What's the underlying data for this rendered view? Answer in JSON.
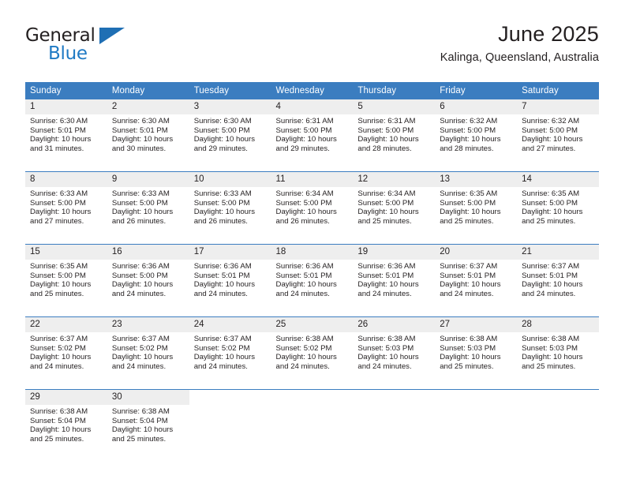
{
  "brand": {
    "name_top": "General",
    "name_bottom": "Blue",
    "triangle_color": "#1f6fb4",
    "blue_color": "#1f7ac4"
  },
  "header": {
    "title": "June 2025",
    "subtitle": "Kalinga, Queensland, Australia"
  },
  "theme": {
    "header_blue": "#3b7dc0",
    "daynum_band": "#eeeeee",
    "text": "#231f20"
  },
  "weekdays": [
    "Sunday",
    "Monday",
    "Tuesday",
    "Wednesday",
    "Thursday",
    "Friday",
    "Saturday"
  ],
  "weeks": [
    [
      {
        "day": "1",
        "sunrise": "Sunrise: 6:30 AM",
        "sunset": "Sunset: 5:01 PM",
        "daylight1": "Daylight: 10 hours",
        "daylight2": "and 31 minutes."
      },
      {
        "day": "2",
        "sunrise": "Sunrise: 6:30 AM",
        "sunset": "Sunset: 5:01 PM",
        "daylight1": "Daylight: 10 hours",
        "daylight2": "and 30 minutes."
      },
      {
        "day": "3",
        "sunrise": "Sunrise: 6:30 AM",
        "sunset": "Sunset: 5:00 PM",
        "daylight1": "Daylight: 10 hours",
        "daylight2": "and 29 minutes."
      },
      {
        "day": "4",
        "sunrise": "Sunrise: 6:31 AM",
        "sunset": "Sunset: 5:00 PM",
        "daylight1": "Daylight: 10 hours",
        "daylight2": "and 29 minutes."
      },
      {
        "day": "5",
        "sunrise": "Sunrise: 6:31 AM",
        "sunset": "Sunset: 5:00 PM",
        "daylight1": "Daylight: 10 hours",
        "daylight2": "and 28 minutes."
      },
      {
        "day": "6",
        "sunrise": "Sunrise: 6:32 AM",
        "sunset": "Sunset: 5:00 PM",
        "daylight1": "Daylight: 10 hours",
        "daylight2": "and 28 minutes."
      },
      {
        "day": "7",
        "sunrise": "Sunrise: 6:32 AM",
        "sunset": "Sunset: 5:00 PM",
        "daylight1": "Daylight: 10 hours",
        "daylight2": "and 27 minutes."
      }
    ],
    [
      {
        "day": "8",
        "sunrise": "Sunrise: 6:33 AM",
        "sunset": "Sunset: 5:00 PM",
        "daylight1": "Daylight: 10 hours",
        "daylight2": "and 27 minutes."
      },
      {
        "day": "9",
        "sunrise": "Sunrise: 6:33 AM",
        "sunset": "Sunset: 5:00 PM",
        "daylight1": "Daylight: 10 hours",
        "daylight2": "and 26 minutes."
      },
      {
        "day": "10",
        "sunrise": "Sunrise: 6:33 AM",
        "sunset": "Sunset: 5:00 PM",
        "daylight1": "Daylight: 10 hours",
        "daylight2": "and 26 minutes."
      },
      {
        "day": "11",
        "sunrise": "Sunrise: 6:34 AM",
        "sunset": "Sunset: 5:00 PM",
        "daylight1": "Daylight: 10 hours",
        "daylight2": "and 26 minutes."
      },
      {
        "day": "12",
        "sunrise": "Sunrise: 6:34 AM",
        "sunset": "Sunset: 5:00 PM",
        "daylight1": "Daylight: 10 hours",
        "daylight2": "and 25 minutes."
      },
      {
        "day": "13",
        "sunrise": "Sunrise: 6:35 AM",
        "sunset": "Sunset: 5:00 PM",
        "daylight1": "Daylight: 10 hours",
        "daylight2": "and 25 minutes."
      },
      {
        "day": "14",
        "sunrise": "Sunrise: 6:35 AM",
        "sunset": "Sunset: 5:00 PM",
        "daylight1": "Daylight: 10 hours",
        "daylight2": "and 25 minutes."
      }
    ],
    [
      {
        "day": "15",
        "sunrise": "Sunrise: 6:35 AM",
        "sunset": "Sunset: 5:00 PM",
        "daylight1": "Daylight: 10 hours",
        "daylight2": "and 25 minutes."
      },
      {
        "day": "16",
        "sunrise": "Sunrise: 6:36 AM",
        "sunset": "Sunset: 5:00 PM",
        "daylight1": "Daylight: 10 hours",
        "daylight2": "and 24 minutes."
      },
      {
        "day": "17",
        "sunrise": "Sunrise: 6:36 AM",
        "sunset": "Sunset: 5:01 PM",
        "daylight1": "Daylight: 10 hours",
        "daylight2": "and 24 minutes."
      },
      {
        "day": "18",
        "sunrise": "Sunrise: 6:36 AM",
        "sunset": "Sunset: 5:01 PM",
        "daylight1": "Daylight: 10 hours",
        "daylight2": "and 24 minutes."
      },
      {
        "day": "19",
        "sunrise": "Sunrise: 6:36 AM",
        "sunset": "Sunset: 5:01 PM",
        "daylight1": "Daylight: 10 hours",
        "daylight2": "and 24 minutes."
      },
      {
        "day": "20",
        "sunrise": "Sunrise: 6:37 AM",
        "sunset": "Sunset: 5:01 PM",
        "daylight1": "Daylight: 10 hours",
        "daylight2": "and 24 minutes."
      },
      {
        "day": "21",
        "sunrise": "Sunrise: 6:37 AM",
        "sunset": "Sunset: 5:01 PM",
        "daylight1": "Daylight: 10 hours",
        "daylight2": "and 24 minutes."
      }
    ],
    [
      {
        "day": "22",
        "sunrise": "Sunrise: 6:37 AM",
        "sunset": "Sunset: 5:02 PM",
        "daylight1": "Daylight: 10 hours",
        "daylight2": "and 24 minutes."
      },
      {
        "day": "23",
        "sunrise": "Sunrise: 6:37 AM",
        "sunset": "Sunset: 5:02 PM",
        "daylight1": "Daylight: 10 hours",
        "daylight2": "and 24 minutes."
      },
      {
        "day": "24",
        "sunrise": "Sunrise: 6:37 AM",
        "sunset": "Sunset: 5:02 PM",
        "daylight1": "Daylight: 10 hours",
        "daylight2": "and 24 minutes."
      },
      {
        "day": "25",
        "sunrise": "Sunrise: 6:38 AM",
        "sunset": "Sunset: 5:02 PM",
        "daylight1": "Daylight: 10 hours",
        "daylight2": "and 24 minutes."
      },
      {
        "day": "26",
        "sunrise": "Sunrise: 6:38 AM",
        "sunset": "Sunset: 5:03 PM",
        "daylight1": "Daylight: 10 hours",
        "daylight2": "and 24 minutes."
      },
      {
        "day": "27",
        "sunrise": "Sunrise: 6:38 AM",
        "sunset": "Sunset: 5:03 PM",
        "daylight1": "Daylight: 10 hours",
        "daylight2": "and 25 minutes."
      },
      {
        "day": "28",
        "sunrise": "Sunrise: 6:38 AM",
        "sunset": "Sunset: 5:03 PM",
        "daylight1": "Daylight: 10 hours",
        "daylight2": "and 25 minutes."
      }
    ],
    [
      {
        "day": "29",
        "sunrise": "Sunrise: 6:38 AM",
        "sunset": "Sunset: 5:04 PM",
        "daylight1": "Daylight: 10 hours",
        "daylight2": "and 25 minutes."
      },
      {
        "day": "30",
        "sunrise": "Sunrise: 6:38 AM",
        "sunset": "Sunset: 5:04 PM",
        "daylight1": "Daylight: 10 hours",
        "daylight2": "and 25 minutes."
      },
      {
        "day": "",
        "sunrise": "",
        "sunset": "",
        "daylight1": "",
        "daylight2": ""
      },
      {
        "day": "",
        "sunrise": "",
        "sunset": "",
        "daylight1": "",
        "daylight2": ""
      },
      {
        "day": "",
        "sunrise": "",
        "sunset": "",
        "daylight1": "",
        "daylight2": ""
      },
      {
        "day": "",
        "sunrise": "",
        "sunset": "",
        "daylight1": "",
        "daylight2": ""
      },
      {
        "day": "",
        "sunrise": "",
        "sunset": "",
        "daylight1": "",
        "daylight2": ""
      }
    ]
  ]
}
